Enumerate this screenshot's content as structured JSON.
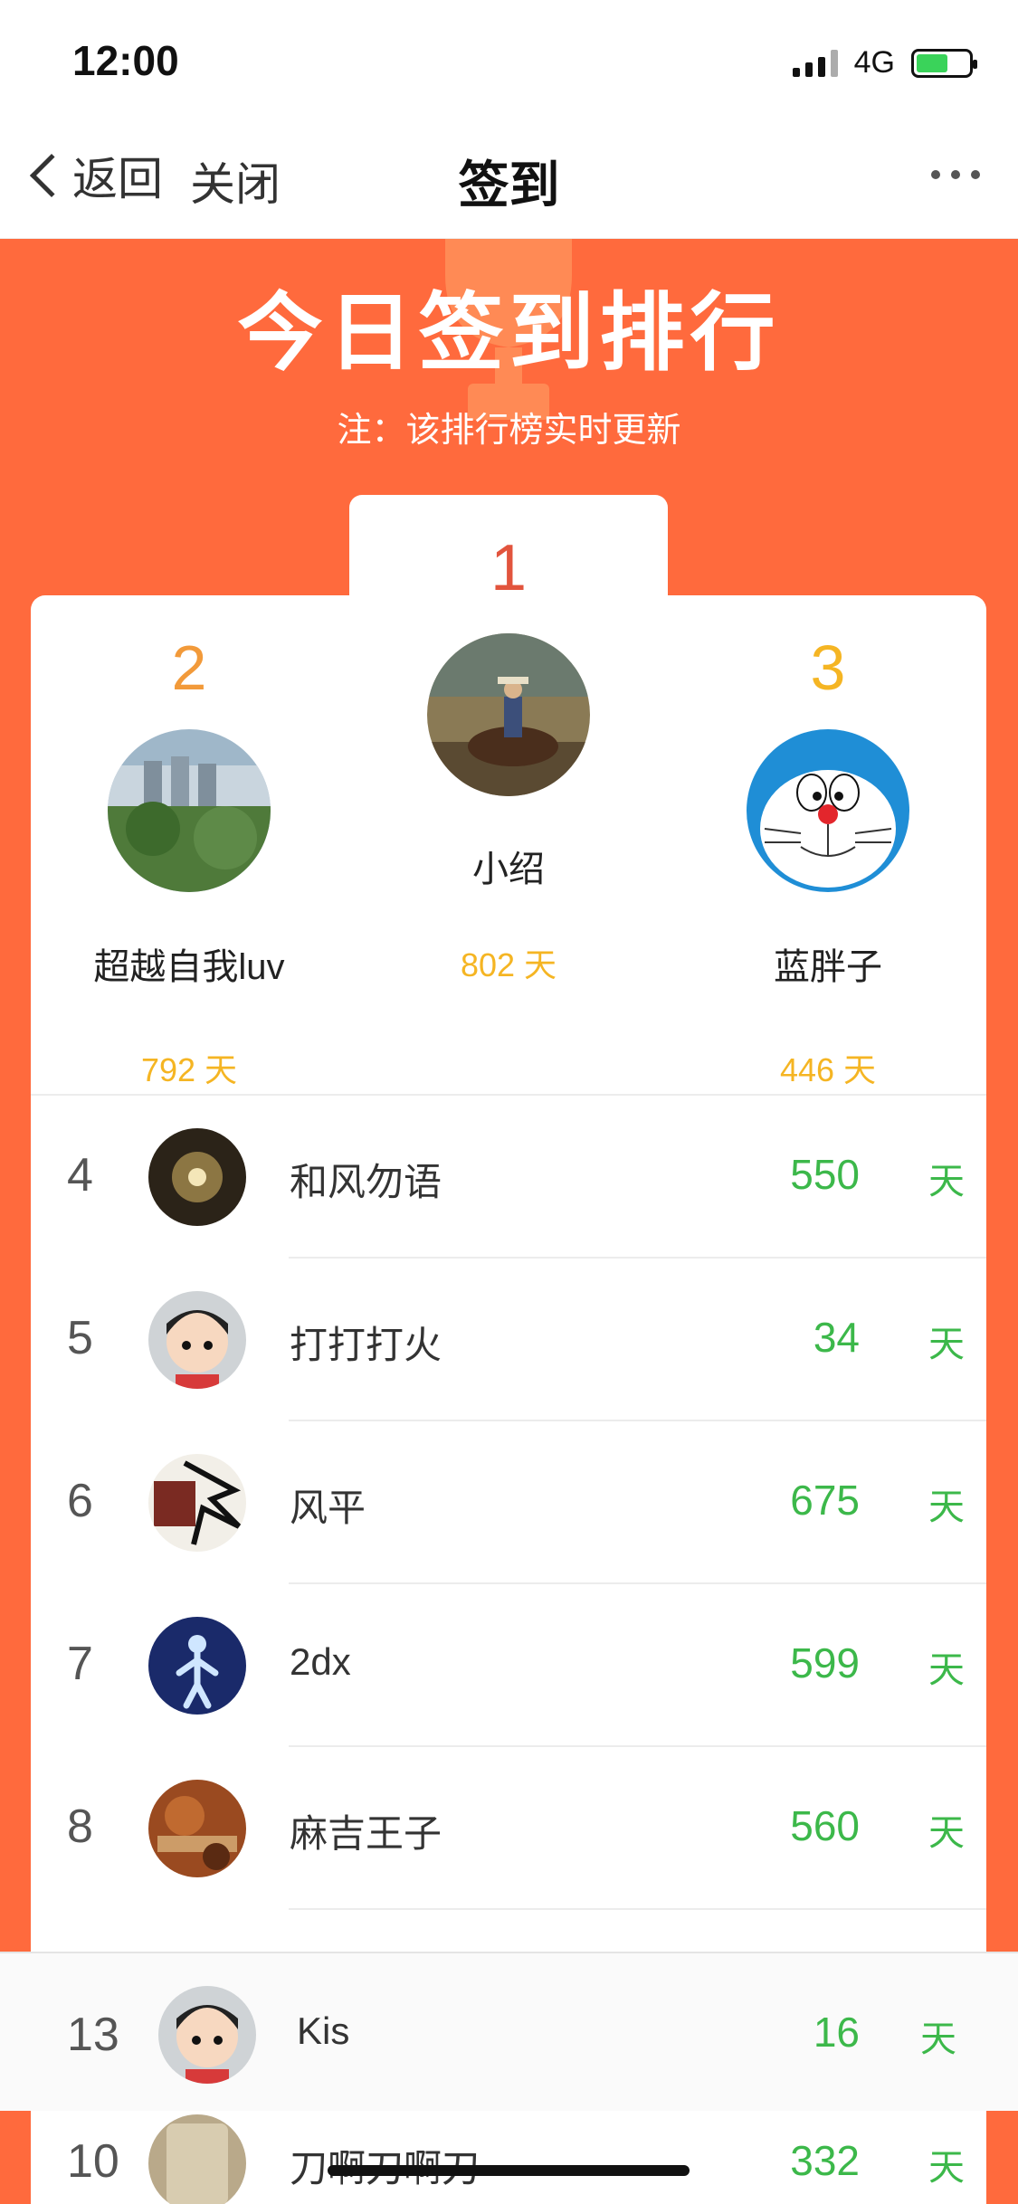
{
  "status_bar": {
    "time": "12:00",
    "network": "4G"
  },
  "nav": {
    "back_label": "返回",
    "close_label": "关闭",
    "title": "签到"
  },
  "banner": {
    "title": "今日签到排行",
    "subtitle": "注：该排行榜实时更新"
  },
  "podium": {
    "first": {
      "rank": "1",
      "name": "小绍",
      "days": "802 天"
    },
    "second": {
      "rank": "2",
      "name": "超越自我luv",
      "days": "792 天"
    },
    "third": {
      "rank": "3",
      "name": "蓝胖子",
      "days": "446 天"
    }
  },
  "ranking": [
    {
      "rank": "4",
      "name": "和风勿语",
      "days": "550",
      "unit": "天"
    },
    {
      "rank": "5",
      "name": "打打打火",
      "days": "34",
      "unit": "天"
    },
    {
      "rank": "6",
      "name": "风平",
      "days": "675",
      "unit": "天"
    },
    {
      "rank": "7",
      "name": "2dx",
      "days": "599",
      "unit": "天"
    },
    {
      "rank": "8",
      "name": "麻吉王子",
      "days": "560",
      "unit": "天"
    }
  ],
  "my_rank": {
    "rank": "13",
    "name": "Kis",
    "days": "16",
    "unit": "天"
  },
  "peek_row": {
    "rank": "10",
    "name": "刀啊刀啊刀",
    "days": "332",
    "unit": "天"
  },
  "colors": {
    "theme_orange": "#ff6a3d",
    "days_green": "#3cb84a",
    "days_gold": "#f5b523"
  }
}
